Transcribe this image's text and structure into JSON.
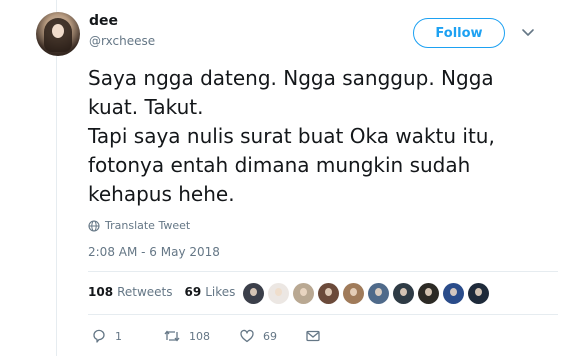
{
  "user": {
    "name": "dee",
    "handle": "@rxcheese"
  },
  "follow_label": "Follow",
  "tweet": {
    "text": "Saya ngga dateng. Ngga sanggup. Ngga\nkuat. Takut.\nTapi saya nulis surat buat Oka waktu itu,\nfotonya entah dimana mungkin sudah\nkehapus hehe.",
    "translate_label": "Translate Tweet",
    "timestamp": "2:08 AM - 6 May 2018"
  },
  "stats": {
    "retweets_count": "108",
    "retweets_label": "Retweets",
    "likes_count": "69",
    "likes_label": "Likes"
  },
  "likers": [
    {
      "color": "#3b3f4a"
    },
    {
      "color": "#ece7e3"
    },
    {
      "color": "#b9a892"
    },
    {
      "color": "#6b4a3a"
    },
    {
      "color": "#a07b5a"
    },
    {
      "color": "#4f6a8a"
    },
    {
      "color": "#2e3b45"
    },
    {
      "color": "#2c2a25"
    },
    {
      "color": "#2a4c8a"
    },
    {
      "color": "#1e2a3a"
    }
  ],
  "actions": {
    "replies": "1",
    "retweets": "108",
    "likes": "69"
  },
  "colors": {
    "accent": "#1da1f2",
    "muted": "#657786",
    "text": "#14171a"
  }
}
